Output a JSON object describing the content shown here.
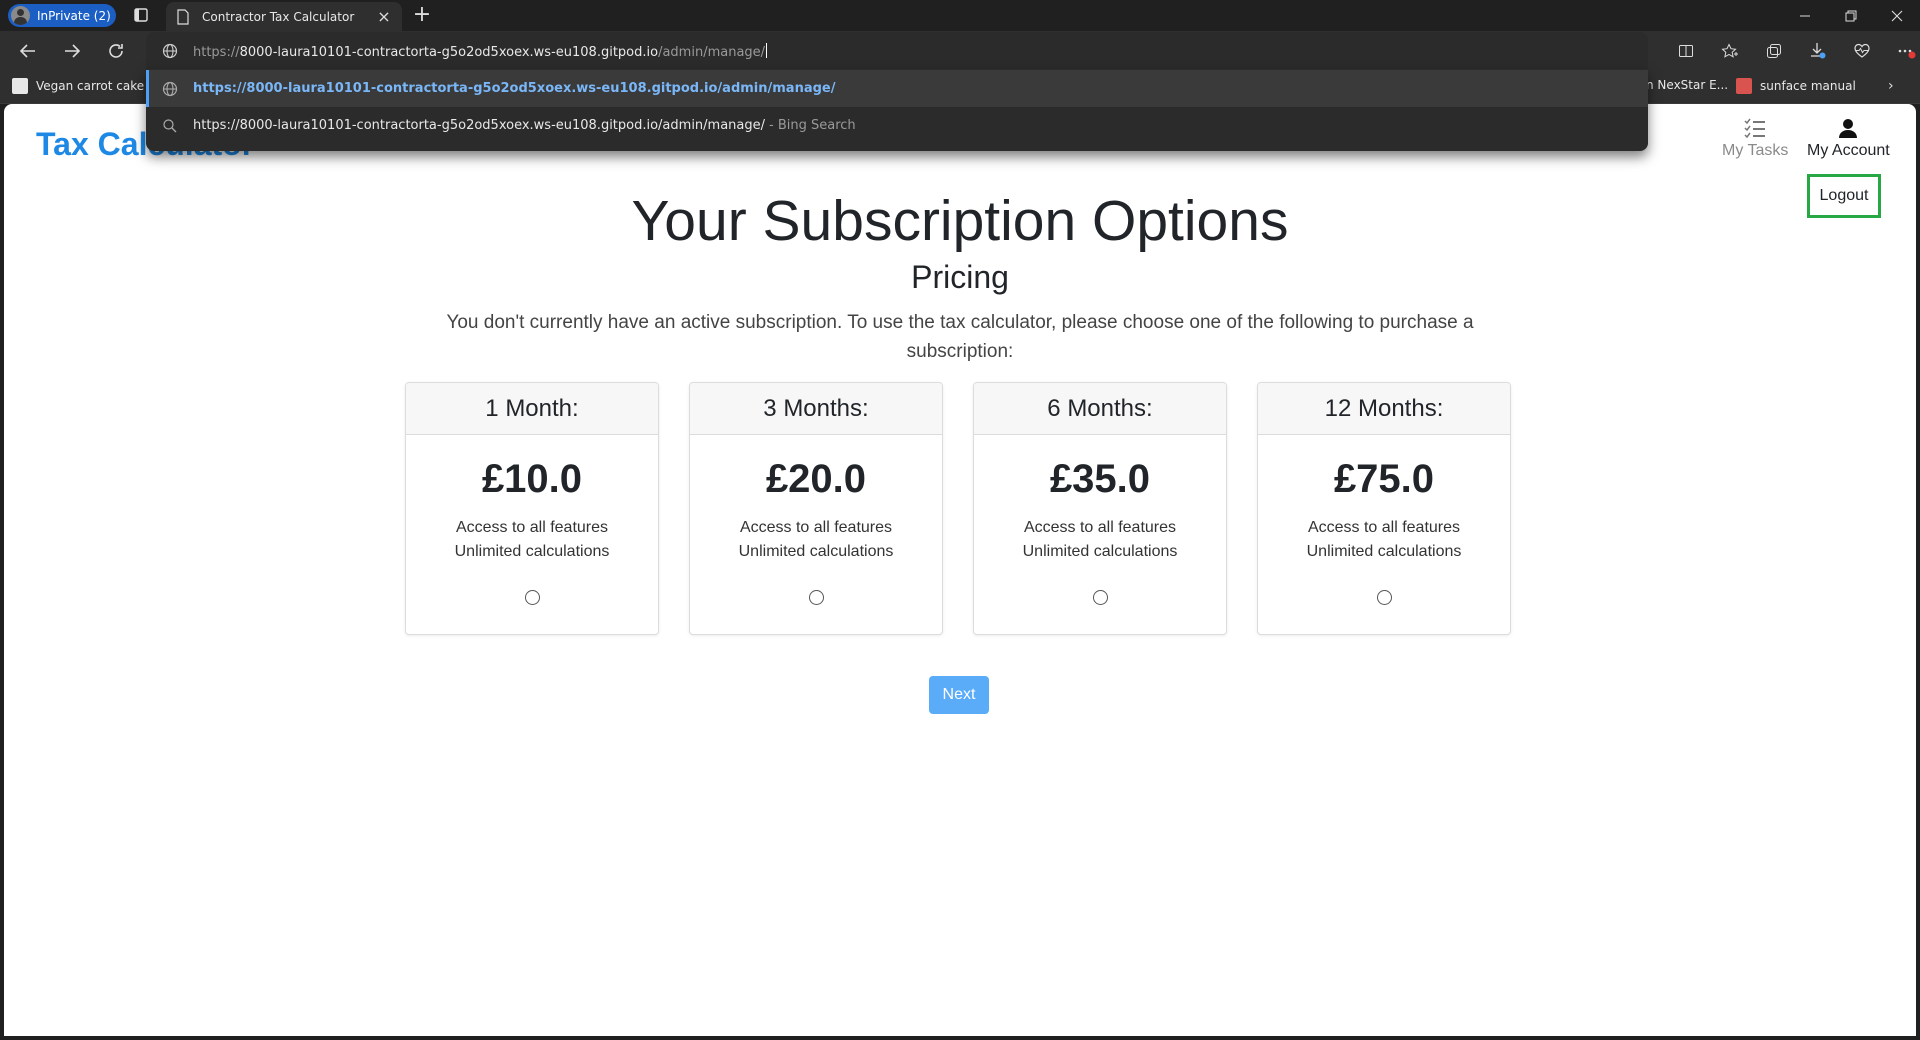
{
  "browser": {
    "profile_label": "InPrivate (2)",
    "tab_title": "Contractor Tax Calculator",
    "tab_close": "×",
    "new_tab": "+",
    "address": {
      "url_prefix": "https://",
      "url_host": "8000-laura10101-contractorta-g5o2od5xoex.ws-eu108.gitpod.io",
      "url_path": "/admin/manage/"
    },
    "suggestions": [
      {
        "text": "https://8000-laura10101-contractorta-g5o2od5xoex.ws-eu108.gitpod.io/admin/manage/",
        "suffix": ""
      },
      {
        "text": "https://8000-laura10101-contractorta-g5o2od5xoex.ws-eu108.gitpod.io/admin/manage/",
        "suffix": "- Bing Search"
      }
    ],
    "bookmarks": [
      {
        "label": "Vegan carrot cake r...",
        "icon_color": "#f4f4f4"
      },
      {
        "label": "n NexStar E...",
        "icon_color": ""
      },
      {
        "label": "sunface manual",
        "icon_color": "#d9534f"
      }
    ]
  },
  "app": {
    "brand": "Tax Calculator",
    "nav": {
      "tasks_label": "My Tasks",
      "account_label": "My Account",
      "logout_label": "Logout"
    },
    "title": "Your Subscription Options",
    "subtitle": "Pricing",
    "lead_line1": "You don't currently have an active subscription. To use the tax calculator, please choose one of the following to purchase a",
    "lead_line2": "subscription:",
    "plans": [
      {
        "name": "1 Month:",
        "price": "£10.0",
        "feature1": "Access to all features",
        "feature2": "Unlimited calculations",
        "selected": false
      },
      {
        "name": "3 Months:",
        "price": "£20.0",
        "feature1": "Access to all features",
        "feature2": "Unlimited calculations",
        "selected": false
      },
      {
        "name": "6 Months:",
        "price": "£35.0",
        "feature1": "Access to all features",
        "feature2": "Unlimited calculations",
        "selected": false
      },
      {
        "name": "12 Months:",
        "price": "£75.0",
        "feature1": "Access to all features",
        "feature2": "Unlimited calculations",
        "selected": false
      }
    ],
    "next_label": "Next",
    "colors": {
      "brand": "#1e88e5",
      "next_button": "#5aacf8",
      "highlight_border": "#28a745"
    }
  }
}
